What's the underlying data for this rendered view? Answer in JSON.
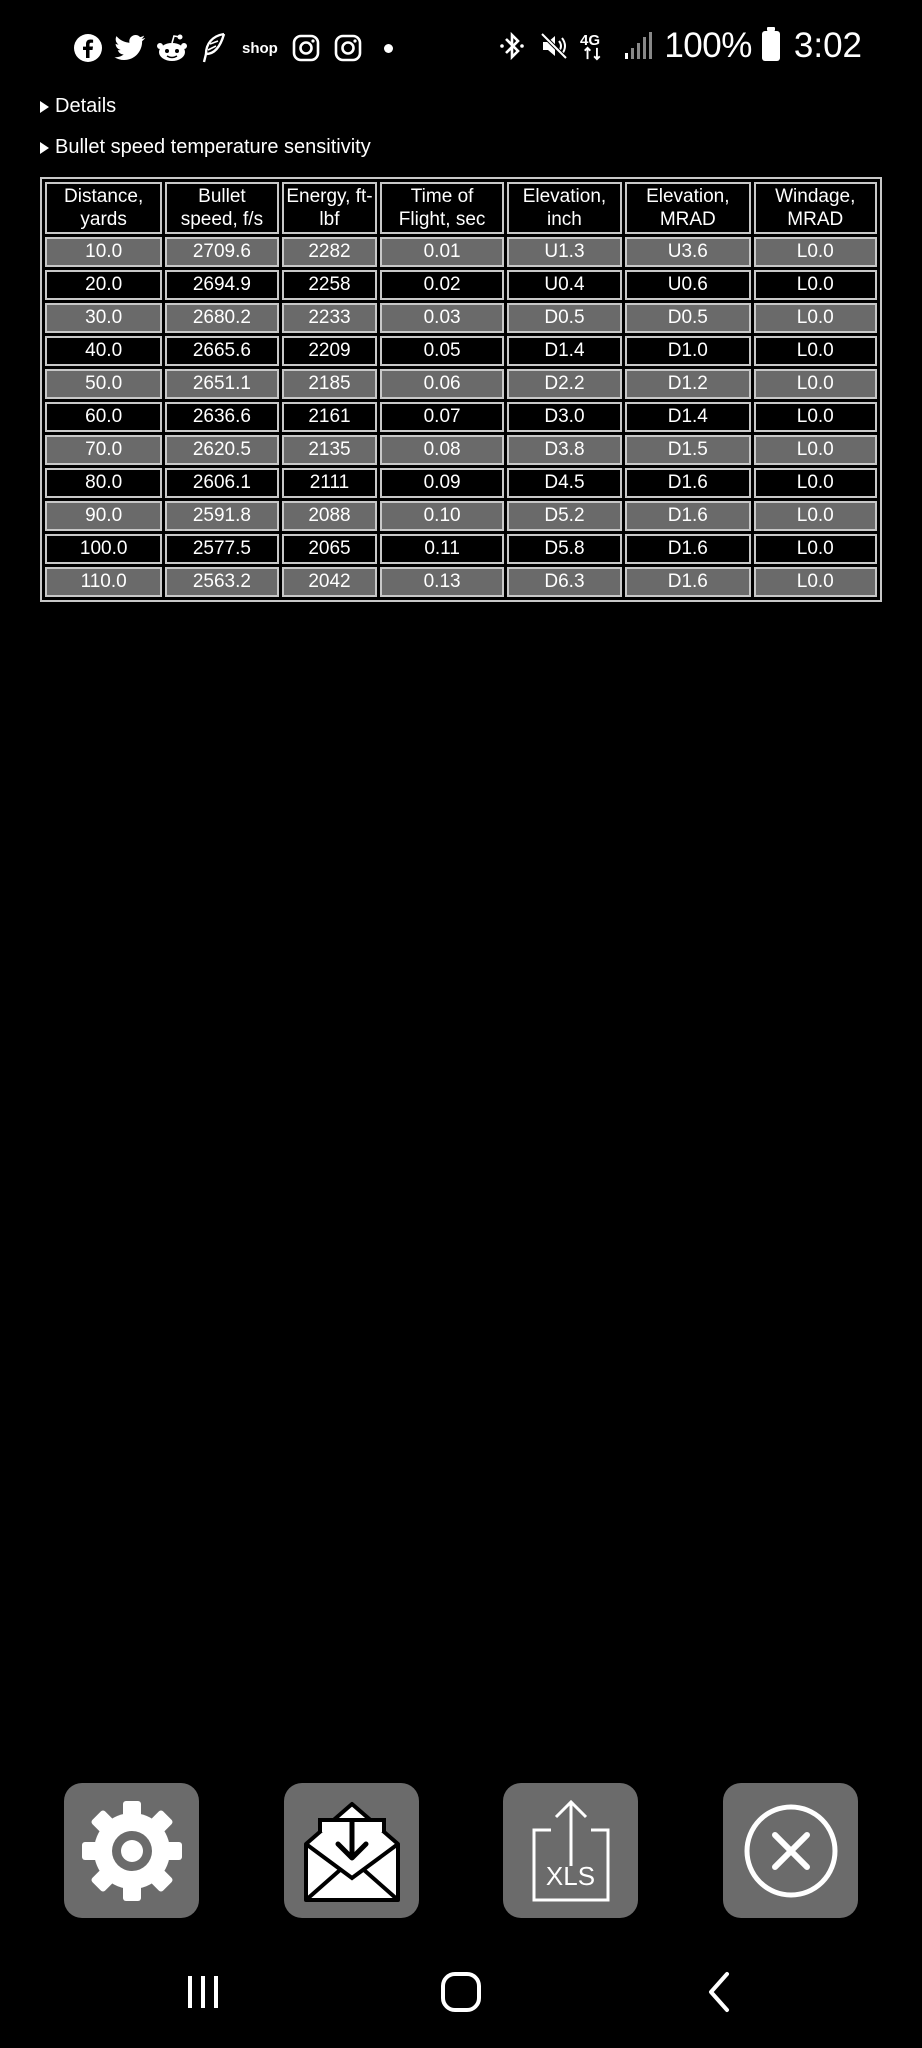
{
  "status_bar": {
    "notification_icons": [
      "facebook-icon",
      "twitter-icon",
      "reddit-icon",
      "feather-icon",
      "shop-icon",
      "instagram-icon",
      "instagram-icon",
      "dot-icon"
    ],
    "shop_label": "shop",
    "system_icons": [
      "bluetooth-icon",
      "mute-icon",
      "4g-lte-icon",
      "signal-icon"
    ],
    "network_label": "4G",
    "battery_percent": "100%",
    "time": "3:02"
  },
  "details": {
    "label": "Details"
  },
  "temperature": {
    "label": "Bullet speed temperature sensitivity"
  },
  "table": {
    "headers": [
      "Distance, yards",
      "Bullet speed, f/s",
      "Energy, ft-lbf",
      "Time of Flight, sec",
      "Elevation, inch",
      "Elevation, MRAD",
      "Windage, MRAD"
    ],
    "rows": [
      [
        "10.0",
        "2709.6",
        "2282",
        "0.01",
        "U1.3",
        "U3.6",
        "L0.0"
      ],
      [
        "20.0",
        "2694.9",
        "2258",
        "0.02",
        "U0.4",
        "U0.6",
        "L0.0"
      ],
      [
        "30.0",
        "2680.2",
        "2233",
        "0.03",
        "D0.5",
        "D0.5",
        "L0.0"
      ],
      [
        "40.0",
        "2665.6",
        "2209",
        "0.05",
        "D1.4",
        "D1.0",
        "L0.0"
      ],
      [
        "50.0",
        "2651.1",
        "2185",
        "0.06",
        "D2.2",
        "D1.2",
        "L0.0"
      ],
      [
        "60.0",
        "2636.6",
        "2161",
        "0.07",
        "D3.0",
        "D1.4",
        "L0.0"
      ],
      [
        "70.0",
        "2620.5",
        "2135",
        "0.08",
        "D3.8",
        "D1.5",
        "L0.0"
      ],
      [
        "80.0",
        "2606.1",
        "2111",
        "0.09",
        "D4.5",
        "D1.6",
        "L0.0"
      ],
      [
        "90.0",
        "2591.8",
        "2088",
        "0.10",
        "D5.2",
        "D1.6",
        "L0.0"
      ],
      [
        "100.0",
        "2577.5",
        "2065",
        "0.11",
        "D5.8",
        "D1.6",
        "L0.0"
      ],
      [
        "110.0",
        "2563.2",
        "2042",
        "0.13",
        "D6.3",
        "D1.6",
        "L0.0"
      ]
    ]
  },
  "toolbar": {
    "buttons": [
      "gear-icon",
      "email-download-icon",
      "xls-export-icon",
      "close-circle-icon"
    ],
    "xls_label": "XLS"
  },
  "nav": {
    "buttons": [
      "recents-icon",
      "home-icon",
      "back-icon"
    ]
  },
  "colors": {
    "background": "#000000",
    "row_shade": "#6a6a6a",
    "button_bg": "#6b6b6b",
    "border": "#c8c8c8"
  }
}
